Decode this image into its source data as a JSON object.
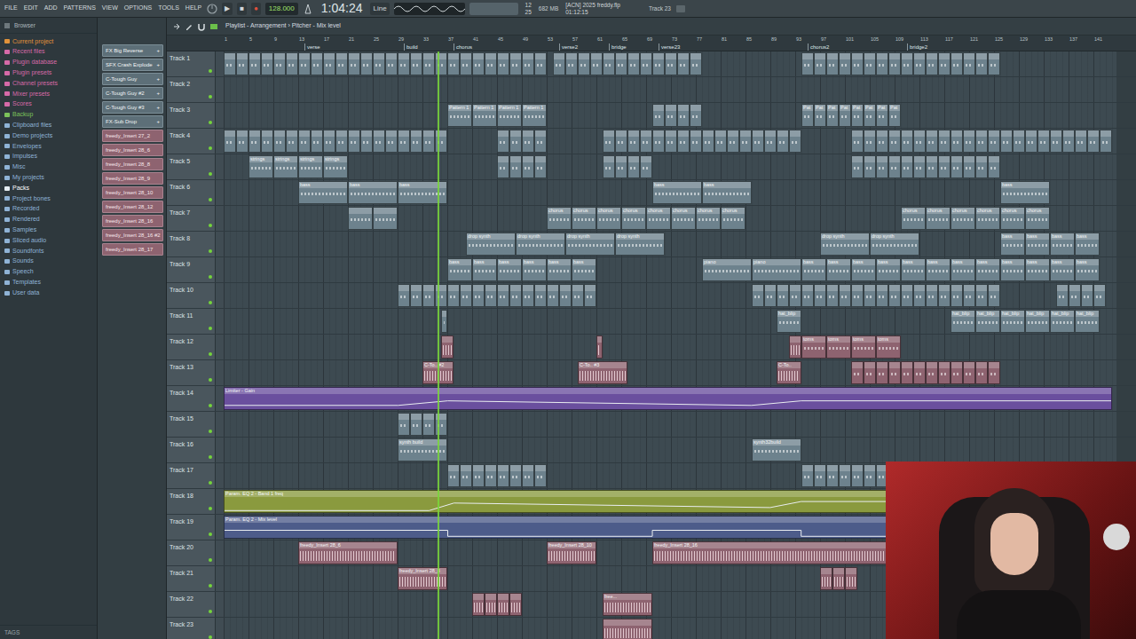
{
  "menu": [
    "FILE",
    "EDIT",
    "ADD",
    "PATTERNS",
    "VIEW",
    "OPTIONS",
    "TOOLS",
    "HELP"
  ],
  "transport": {
    "play": "▶",
    "stop": "■",
    "record": "●",
    "tempo": "128.000",
    "time": "1:04:24",
    "snap": "Line"
  },
  "project": {
    "title": "[ACN] 2025 freddy.flp",
    "time": "01:12:15",
    "hint": "Track 23",
    "memory": "682 MB",
    "cpu": "12",
    "polyphony": "25"
  },
  "browser": {
    "title": "Browser",
    "footer": "TAGS",
    "items": [
      {
        "label": "Current project",
        "color": "#e0923a",
        "selected": false
      },
      {
        "label": "Recent files",
        "color": "#d66aa8",
        "selected": false
      },
      {
        "label": "Plugin database",
        "color": "#d66aa8",
        "selected": false
      },
      {
        "label": "Plugin presets",
        "color": "#d66aa8",
        "selected": false
      },
      {
        "label": "Channel presets",
        "color": "#d66aa8",
        "selected": false
      },
      {
        "label": "Mixer presets",
        "color": "#d66aa8",
        "selected": false
      },
      {
        "label": "Scores",
        "color": "#d66aa8",
        "selected": false
      },
      {
        "label": "Backup",
        "color": "#7cc25a",
        "selected": false
      },
      {
        "label": "Clipboard files",
        "color": "#8fb3d6",
        "selected": false
      },
      {
        "label": "Demo projects",
        "color": "#8fb3d6",
        "selected": false
      },
      {
        "label": "Envelopes",
        "color": "#8fb3d6",
        "selected": false
      },
      {
        "label": "Impulses",
        "color": "#8fb3d6",
        "selected": false
      },
      {
        "label": "Misc",
        "color": "#8fb3d6",
        "selected": false
      },
      {
        "label": "My projects",
        "color": "#8fb3d6",
        "selected": false
      },
      {
        "label": "Packs",
        "color": "#e6eef3",
        "selected": true
      },
      {
        "label": "Project bones",
        "color": "#8fb3d6",
        "selected": false
      },
      {
        "label": "Recorded",
        "color": "#8fb3d6",
        "selected": false
      },
      {
        "label": "Rendered",
        "color": "#8fb3d6",
        "selected": false
      },
      {
        "label": "Samples",
        "color": "#8fb3d6",
        "selected": false
      },
      {
        "label": "Sliced audio",
        "color": "#8fb3d6",
        "selected": false
      },
      {
        "label": "Soundfonts",
        "color": "#8fb3d6",
        "selected": false
      },
      {
        "label": "Sounds",
        "color": "#8fb3d6",
        "selected": false
      },
      {
        "label": "Speech",
        "color": "#8fb3d6",
        "selected": false
      },
      {
        "label": "Templates",
        "color": "#8fb3d6",
        "selected": false
      },
      {
        "label": "User data",
        "color": "#8fb3d6",
        "selected": false
      }
    ]
  },
  "picker": [
    {
      "label": "FX Big Reverse",
      "kind": "pattern",
      "plus": "+"
    },
    {
      "label": "SFX Crash Explode",
      "kind": "pattern",
      "plus": "+"
    },
    {
      "label": "C-Tough Guy",
      "kind": "pattern",
      "plus": "+"
    },
    {
      "label": "C-Tough Guy #2",
      "kind": "pattern",
      "plus": "+"
    },
    {
      "label": "C-Tough Guy #3",
      "kind": "pattern",
      "plus": "+"
    },
    {
      "label": "FX-Sub Drop",
      "kind": "pattern",
      "plus": "+"
    },
    {
      "label": "freedy_Insert 27_2",
      "kind": "audio"
    },
    {
      "label": "freedy_Insert 28_6",
      "kind": "audio"
    },
    {
      "label": "freedy_Insert 28_8",
      "kind": "audio"
    },
    {
      "label": "freedy_Insert 28_9",
      "kind": "audio"
    },
    {
      "label": "freedy_Insert 28_10",
      "kind": "audio"
    },
    {
      "label": "freedy_Insert 28_12",
      "kind": "audio"
    },
    {
      "label": "freedy_Insert 28_16",
      "kind": "audio"
    },
    {
      "label": "freedy_Insert 28_16 #2",
      "kind": "audio"
    },
    {
      "label": "freedy_Insert 28_17",
      "kind": "audio"
    }
  ],
  "playlist": {
    "title": "Playlist - Arrangement › Pitcher - Mix level",
    "ruler": [
      "1",
      "5",
      "9",
      "13",
      "17",
      "21",
      "25",
      "29",
      "33",
      "37",
      "41",
      "45",
      "49",
      "53",
      "57",
      "61",
      "65",
      "69",
      "73",
      "77",
      "81",
      "85",
      "89",
      "93",
      "97",
      "101",
      "105",
      "109",
      "113",
      "117",
      "121",
      "125",
      "129",
      "133",
      "137",
      "141"
    ],
    "markers": [
      {
        "label": "verse",
        "bar": 13
      },
      {
        "label": "build",
        "bar": 29
      },
      {
        "label": "chorus",
        "bar": 37
      },
      {
        "label": "verse2",
        "bar": 54
      },
      {
        "label": "bridge",
        "bar": 62
      },
      {
        "label": "verse23",
        "bar": 70
      },
      {
        "label": "chorus2",
        "bar": 94
      },
      {
        "label": "bridge2",
        "bar": 110
      }
    ],
    "playhead_bar": 34.4,
    "tracks": [
      {
        "label": "Track 1",
        "color": "#6d828d",
        "clips": [
          {
            "kind": "pattern",
            "label": "",
            "start": 0,
            "len": 2,
            "repeat": 18
          },
          {
            "kind": "pattern",
            "label": "",
            "start": 36,
            "len": 2,
            "repeat": 8
          },
          {
            "kind": "pattern",
            "label": "",
            "start": 53,
            "len": 2,
            "repeat": 12
          },
          {
            "kind": "pattern",
            "label": "",
            "start": 93,
            "len": 2,
            "repeat": 16
          }
        ]
      },
      {
        "label": "Track 2",
        "color": "#6d828d",
        "clips": []
      },
      {
        "label": "Track 3",
        "color": "#6d828d",
        "clips": [
          {
            "kind": "pattern",
            "label": "Pattern 1",
            "start": 36,
            "len": 4,
            "repeat": 4
          },
          {
            "kind": "pattern",
            "label": "",
            "start": 69,
            "len": 2,
            "repeat": 4
          },
          {
            "kind": "pattern",
            "label": "Pat",
            "start": 93,
            "len": 2,
            "repeat": 8
          }
        ]
      },
      {
        "label": "Track 4",
        "color": "#6d828d",
        "clips": [
          {
            "kind": "pattern",
            "label": "",
            "start": 0,
            "len": 2,
            "repeat": 18
          },
          {
            "kind": "pattern",
            "label": "",
            "start": 44,
            "len": 2,
            "repeat": 4
          },
          {
            "kind": "pattern",
            "label": "",
            "start": 61,
            "len": 2,
            "repeat": 16
          },
          {
            "kind": "pattern",
            "label": "",
            "start": 101,
            "len": 2,
            "repeat": 21
          }
        ]
      },
      {
        "label": "Track 5",
        "color": "#6d828d",
        "clips": [
          {
            "kind": "pattern",
            "label": "strings",
            "start": 4,
            "len": 4,
            "repeat": 4
          },
          {
            "kind": "pattern",
            "label": "",
            "start": 44,
            "len": 2,
            "repeat": 4
          },
          {
            "kind": "pattern",
            "label": "",
            "start": 61,
            "len": 2,
            "repeat": 4
          },
          {
            "kind": "pattern",
            "label": "",
            "start": 101,
            "len": 2,
            "repeat": 12
          }
        ]
      },
      {
        "label": "Track 6",
        "color": "#6d828d",
        "clips": [
          {
            "kind": "pattern",
            "label": "bass",
            "start": 12,
            "len": 8,
            "repeat": 3
          },
          {
            "kind": "pattern",
            "label": "bass",
            "start": 69,
            "len": 8,
            "repeat": 2
          },
          {
            "kind": "pattern",
            "label": "bass",
            "start": 125,
            "len": 8,
            "repeat": 1
          }
        ]
      },
      {
        "label": "Track 7",
        "color": "#6d828d",
        "clips": [
          {
            "kind": "pattern",
            "label": "",
            "start": 20,
            "len": 4,
            "repeat": 2
          },
          {
            "kind": "pattern",
            "label": "chorus",
            "start": 52,
            "len": 4,
            "repeat": 8
          },
          {
            "kind": "pattern",
            "label": "chorus",
            "start": 109,
            "len": 4,
            "repeat": 6
          }
        ]
      },
      {
        "label": "Track 8",
        "color": "#6d828d",
        "clips": [
          {
            "kind": "pattern",
            "label": "drop synth",
            "start": 39,
            "len": 8,
            "repeat": 4
          },
          {
            "kind": "pattern",
            "label": "drop synth",
            "start": 96,
            "len": 8,
            "repeat": 2
          },
          {
            "kind": "pattern",
            "label": "bass",
            "start": 125,
            "len": 4,
            "repeat": 4
          }
        ]
      },
      {
        "label": "Track 9",
        "color": "#6d828d",
        "clips": [
          {
            "kind": "pattern",
            "label": "bass",
            "start": 36,
            "len": 4,
            "repeat": 6
          },
          {
            "kind": "pattern",
            "label": "piano",
            "start": 77,
            "len": 8,
            "repeat": 2
          },
          {
            "kind": "pattern",
            "label": "bass",
            "start": 93,
            "len": 4,
            "repeat": 12
          }
        ]
      },
      {
        "label": "Track 10",
        "color": "#6d828d",
        "clips": [
          {
            "kind": "pattern",
            "label": "",
            "start": 28,
            "len": 2,
            "repeat": 4
          },
          {
            "kind": "pattern",
            "label": "",
            "start": 36,
            "len": 2,
            "repeat": 12
          },
          {
            "kind": "pattern",
            "label": "",
            "start": 85,
            "len": 2,
            "repeat": 20
          },
          {
            "kind": "pattern",
            "label": "",
            "start": 134,
            "len": 2,
            "repeat": 4
          }
        ]
      },
      {
        "label": "Track 11",
        "color": "#6d828d",
        "clips": [
          {
            "kind": "pattern",
            "label": "",
            "start": 35,
            "len": 1,
            "repeat": 1
          },
          {
            "kind": "pattern",
            "label": "hat_blip",
            "start": 89,
            "len": 4,
            "repeat": 1
          },
          {
            "kind": "pattern",
            "label": "hat_blip",
            "start": 117,
            "len": 4,
            "repeat": 6
          }
        ]
      },
      {
        "label": "Track 12",
        "color": "#8e6370",
        "clips": [
          {
            "kind": "audio",
            "label": "",
            "start": 35,
            "len": 2,
            "repeat": 1
          },
          {
            "kind": "audio",
            "label": "",
            "start": 60,
            "len": 1,
            "repeat": 1
          },
          {
            "kind": "audio",
            "label": "",
            "start": 91,
            "len": 2,
            "repeat": 1
          },
          {
            "kind": "pattern",
            "label": "toms",
            "start": 93,
            "len": 4,
            "repeat": 4
          }
        ]
      },
      {
        "label": "Track 13",
        "color": "#8e6370",
        "clips": [
          {
            "kind": "audio",
            "label": "C-To.. #2",
            "start": 32,
            "len": 5,
            "repeat": 1
          },
          {
            "kind": "audio",
            "label": "C-To.. #3",
            "start": 57,
            "len": 8,
            "repeat": 1
          },
          {
            "kind": "audio",
            "label": "C-To..",
            "start": 89,
            "len": 4,
            "repeat": 1
          },
          {
            "kind": "pattern",
            "label": "",
            "start": 101,
            "len": 2,
            "repeat": 12
          }
        ]
      },
      {
        "label": "Track 14",
        "color": "#6a4f9e",
        "clips": [
          {
            "kind": "automation",
            "label": "Limiter - Gain",
            "start": 0,
            "len": 143,
            "repeat": 1,
            "curve": [
              [
                0,
                0.25
              ],
              [
                28,
                0.25
              ],
              [
                36,
                0.55
              ],
              [
                85,
                0.25
              ],
              [
                93,
                0.55
              ],
              [
                143,
                0.55
              ]
            ]
          }
        ]
      },
      {
        "label": "Track 15",
        "color": "#6d828d",
        "clips": [
          {
            "kind": "pattern",
            "label": "",
            "start": 28,
            "len": 2,
            "repeat": 4
          }
        ]
      },
      {
        "label": "Track 16",
        "color": "#6d828d",
        "clips": [
          {
            "kind": "pattern",
            "label": "synth build",
            "start": 28,
            "len": 8,
            "repeat": 1
          },
          {
            "kind": "pattern",
            "label": "synth32build",
            "start": 85,
            "len": 8,
            "repeat": 1
          }
        ]
      },
      {
        "label": "Track 17",
        "color": "#6d828d",
        "clips": [
          {
            "kind": "pattern",
            "label": "",
            "start": 36,
            "len": 2,
            "repeat": 8
          },
          {
            "kind": "pattern",
            "label": "",
            "start": 93,
            "len": 2,
            "repeat": 16
          }
        ]
      },
      {
        "label": "Track 18",
        "color": "#8a9a3e",
        "clips": [
          {
            "kind": "automation",
            "label": "Param. EQ 2 - Band 1 freq",
            "start": 0,
            "len": 143,
            "repeat": 1,
            "curve": [
              [
                0,
                0.1
              ],
              [
                33,
                0.1
              ],
              [
                37,
                0.6
              ],
              [
                88,
                0.3
              ],
              [
                93,
                0.7
              ],
              [
                143,
                0.7
              ]
            ]
          }
        ]
      },
      {
        "label": "Track 19",
        "color": "#4d5c8a",
        "clips": [
          {
            "kind": "automation",
            "label": "Param. EQ 2 - Mix level",
            "start": 0,
            "len": 143,
            "repeat": 1,
            "curve": [
              [
                0,
                0.5
              ],
              [
                36,
                0.5
              ],
              [
                36,
                0.1
              ],
              [
                69,
                0.1
              ],
              [
                69,
                0.5
              ],
              [
                93,
                0.5
              ],
              [
                93,
                0.1
              ],
              [
                143,
                0.1
              ]
            ]
          }
        ]
      },
      {
        "label": "Track 20",
        "color": "#8e6370",
        "clips": [
          {
            "kind": "audio",
            "label": "freedy_Insert 28_6",
            "start": 12,
            "len": 16,
            "repeat": 1
          },
          {
            "kind": "audio",
            "label": "freedy_Insert 28_10",
            "start": 52,
            "len": 8,
            "repeat": 1
          },
          {
            "kind": "audio",
            "label": "freedy_Insert 28_16",
            "start": 69,
            "len": 38,
            "repeat": 1
          }
        ]
      },
      {
        "label": "Track 21",
        "color": "#8e6370",
        "clips": [
          {
            "kind": "audio",
            "label": "freedy_Insert 28_8",
            "start": 28,
            "len": 8,
            "repeat": 1
          },
          {
            "kind": "audio",
            "label": "",
            "start": 96,
            "len": 2,
            "repeat": 3
          }
        ]
      },
      {
        "label": "Track 22",
        "color": "#8e6370",
        "clips": [
          {
            "kind": "audio",
            "label": "",
            "start": 40,
            "len": 2,
            "repeat": 4
          },
          {
            "kind": "audio",
            "label": "free...",
            "start": 61,
            "len": 8,
            "repeat": 1
          }
        ]
      },
      {
        "label": "Track 23",
        "color": "#8e6370",
        "clips": [
          {
            "kind": "audio",
            "label": "",
            "start": 61,
            "len": 8,
            "repeat": 1
          }
        ]
      }
    ]
  }
}
